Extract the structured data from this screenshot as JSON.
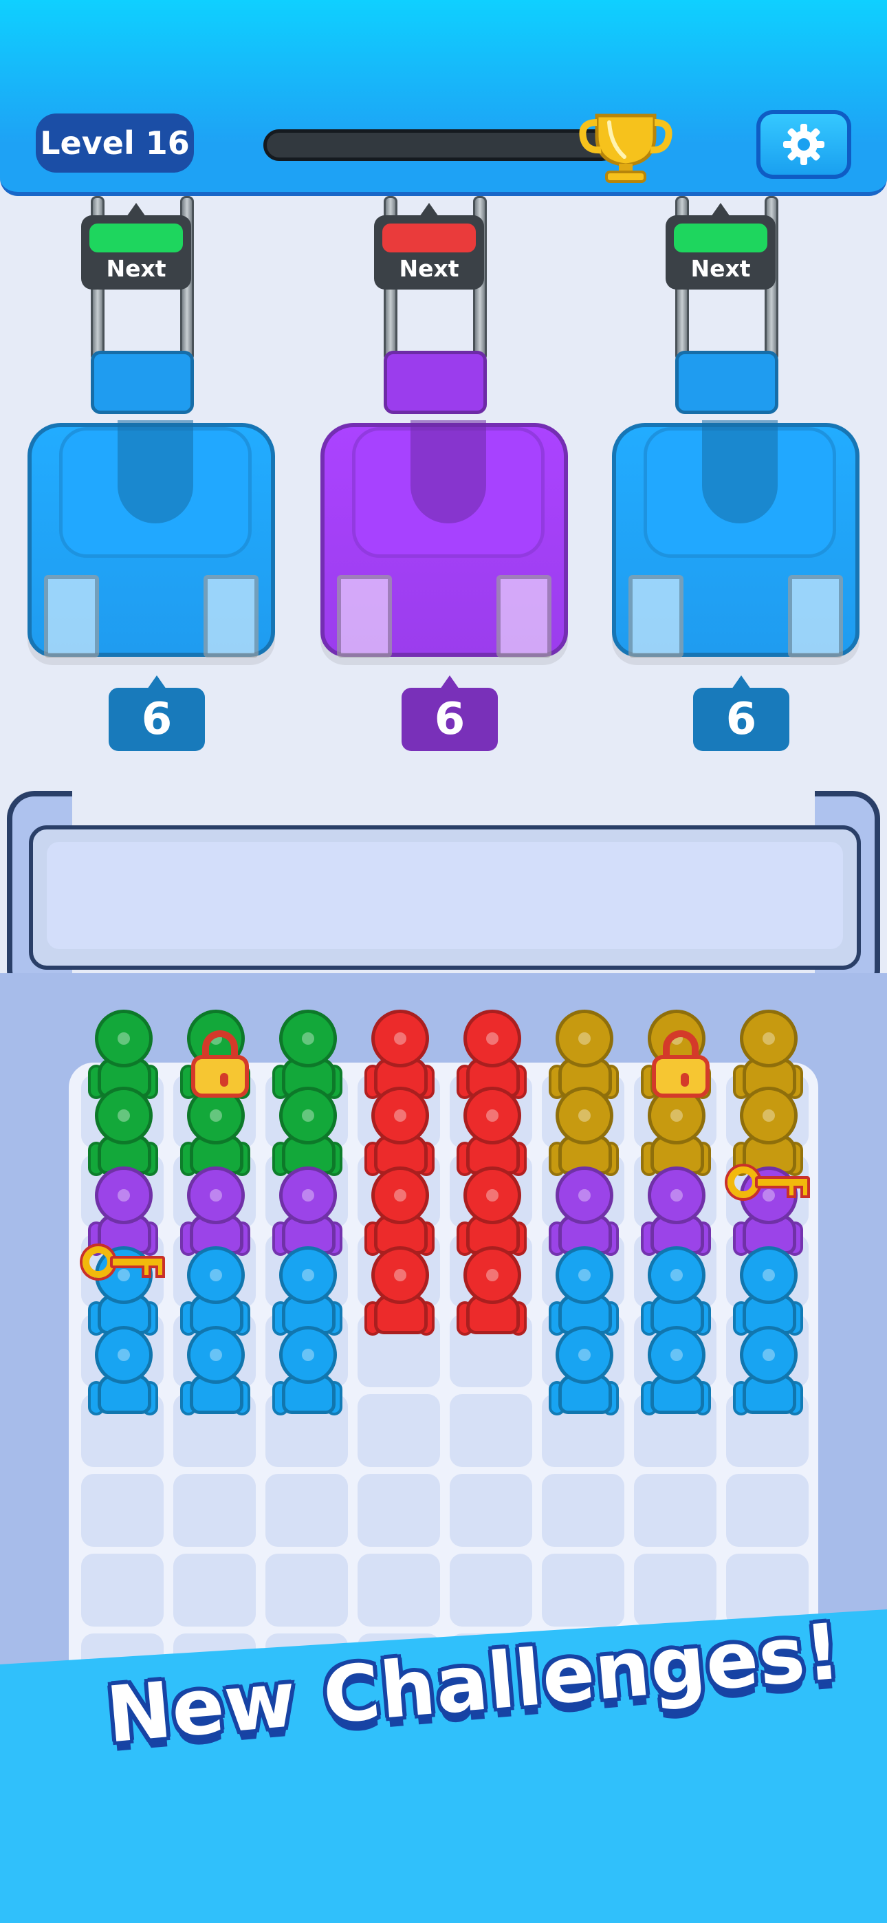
{
  "hud": {
    "level_label": "Level 16",
    "progress": 0.0,
    "trophy_icon": "trophy-icon",
    "settings_icon": "gear-icon"
  },
  "machines": [
    {
      "next_label": "Next",
      "indicator_color": "#1ed65e",
      "color": "#1f9cf0",
      "count": "6"
    },
    {
      "next_label": "Next",
      "indicator_color": "#ea3b3b",
      "color": "#9b3ded",
      "count": "6"
    },
    {
      "next_label": "Next",
      "indicator_color": "#1ed65e",
      "color": "#1f9cf0",
      "count": "6"
    }
  ],
  "board": {
    "columns": 8,
    "rows": 8,
    "palette": {
      "green": "#13a83a",
      "red": "#ec2b2b",
      "olive": "#c79a10",
      "purple": "#9b44e8",
      "blue": "#18a4f2"
    },
    "stacks": [
      [
        "green",
        "green",
        "purple",
        "blue",
        "blue"
      ],
      [
        "green",
        "green",
        "purple",
        "blue",
        "blue"
      ],
      [
        "green",
        "green",
        "purple",
        "blue",
        "blue"
      ],
      [
        "red",
        "red",
        "red",
        "red"
      ],
      [
        "red",
        "red",
        "red",
        "red"
      ],
      [
        "olive",
        "olive",
        "purple",
        "blue",
        "blue"
      ],
      [
        "olive",
        "olive",
        "purple",
        "blue",
        "blue"
      ],
      [
        "olive",
        "olive",
        "purple",
        "blue",
        "blue"
      ]
    ],
    "locks": [
      {
        "col": 1,
        "row": 0
      },
      {
        "col": 6,
        "row": 0
      }
    ],
    "keys": [
      {
        "col": 0,
        "row": 2
      },
      {
        "col": 7,
        "row": 1
      }
    ]
  },
  "banner": {
    "text": "New Challenges!"
  }
}
